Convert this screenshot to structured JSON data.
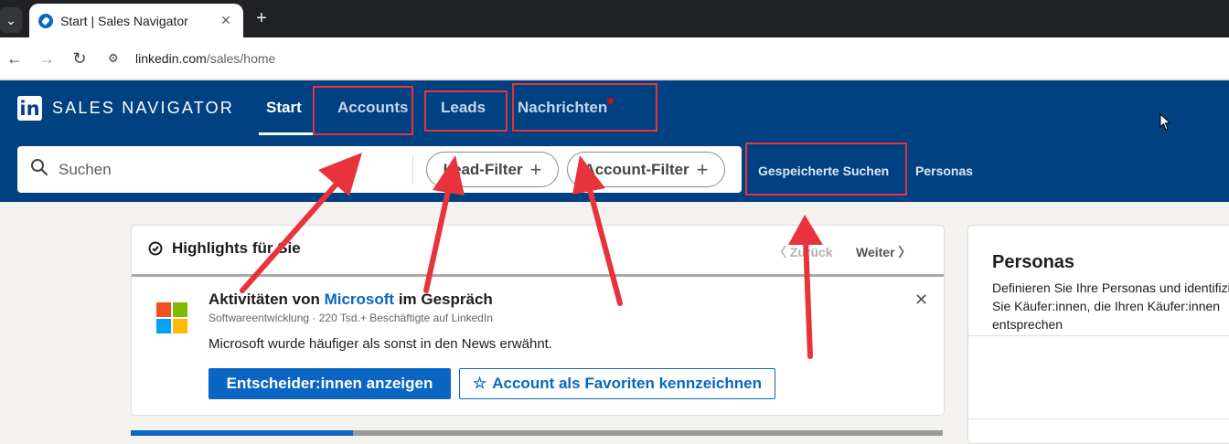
{
  "browser": {
    "tab_title": "Start | Sales Navigator",
    "tab_close": "✕",
    "new_tab": "+",
    "url_host": "linkedin.com",
    "url_path": "/sales/home",
    "back": "←",
    "forward": "→",
    "reload": "↻"
  },
  "header": {
    "logo_in": "in",
    "logo_text": "SALES NAVIGATOR",
    "nav": [
      {
        "label": "Start"
      },
      {
        "label": "Accounts"
      },
      {
        "label": "Leads"
      },
      {
        "label": "Nachrichten"
      }
    ],
    "search_placeholder": "Suchen",
    "lead_filter": "Lead-Filter",
    "account_filter": "Account-Filter",
    "plus": "+",
    "saved_searches": "Gespeicherte Suchen",
    "personas": "Personas"
  },
  "highlights": {
    "title": "Highlights für Sie",
    "back": "〈  Zurück",
    "next": "Weiter  〉",
    "activity_prefix": "Aktivitäten von ",
    "activity_company": "Microsoft",
    "activity_suffix": " im Gespräch",
    "subtitle": "Softwareentwicklung · 220 Tsd.+ Beschäftigte auf LinkedIn",
    "body": "Microsoft wurde häufiger als sonst in den News erwähnt.",
    "close": "✕",
    "primary_button": "Entscheider:innen anzeigen",
    "secondary_button": "Account als Favoriten kennzeichnen",
    "star": "☆"
  },
  "personas_card": {
    "title": "Personas",
    "desc": "Definieren Sie Ihre Personas und identifizieren Sie Käufer:innen, die Ihren Käufer:innen entsprechen"
  },
  "colors": {
    "header_bg": "#004182",
    "brand_blue": "#0a66c2",
    "annotation_red": "#e8323c"
  }
}
